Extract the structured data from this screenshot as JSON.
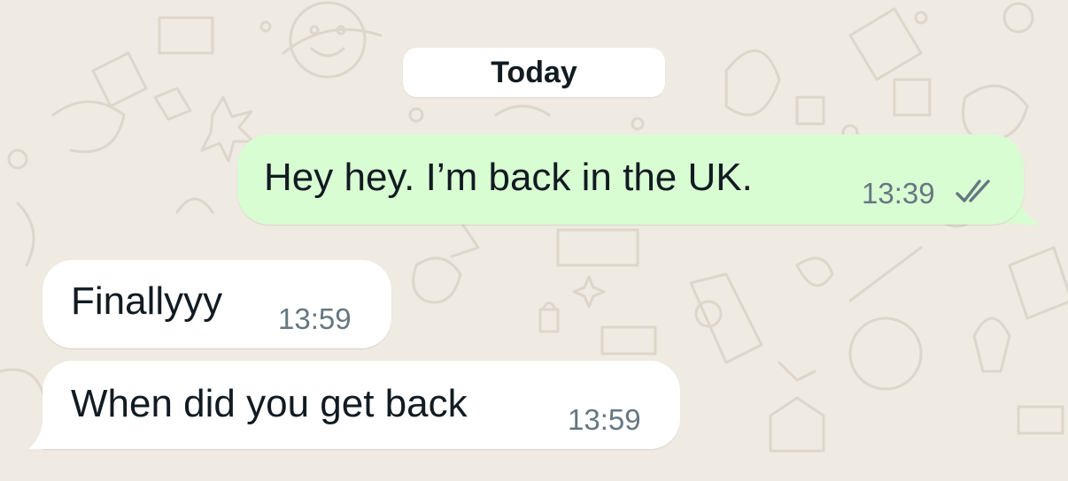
{
  "chat": {
    "date_divider": "Today",
    "messages": [
      {
        "direction": "outgoing",
        "text": "Hey hey. I’m back in the UK.",
        "time": "13:39",
        "status_icon": "double-check-icon"
      },
      {
        "direction": "incoming",
        "text": "Finallyyy",
        "time": "13:59"
      },
      {
        "direction": "incoming",
        "text": "When did you get back",
        "time": "13:59"
      }
    ]
  },
  "colors": {
    "wallpaper": "#efeae2",
    "outgoing_bubble": "#d9fdd3",
    "incoming_bubble": "#ffffff",
    "timestamp": "#667781",
    "text": "#111b21"
  }
}
